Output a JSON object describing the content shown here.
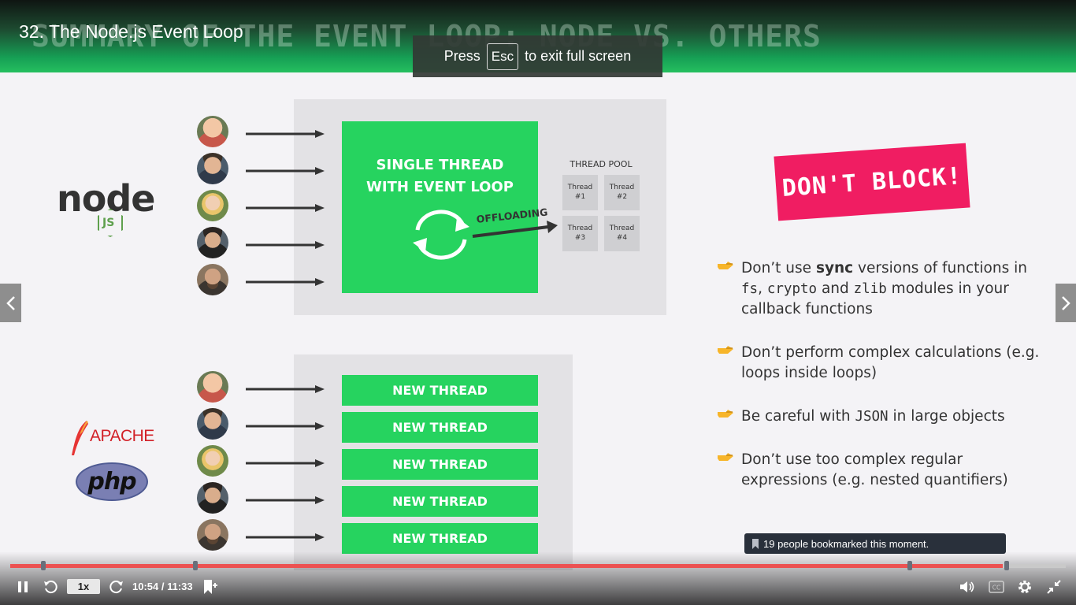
{
  "player": {
    "title": "32. The Node.js Event Loop",
    "fullscreen_toast": {
      "before": "Press",
      "key": "Esc",
      "after": "to exit full screen"
    },
    "bookmark_tooltip": "19 people bookmarked this moment.",
    "playback_rate": "1x",
    "time": "10:54 / 11:33",
    "progress": 0.94,
    "bookmarks": [
      0.031,
      0.175,
      0.852,
      0.944
    ]
  },
  "slide": {
    "header": "SUMMARY OF THE EVENT LOOP: NODE VS. OTHERS",
    "logos": {
      "node": "node",
      "node_badge": "JS",
      "apache": "APACHE",
      "php": "php"
    },
    "single_thread_label": "SINGLE THREAD\nWITH EVENT LOOP",
    "offloading": "OFFLOADING",
    "thread_pool": {
      "title": "THREAD POOL",
      "threads": [
        "Thread\n#1",
        "Thread\n#2",
        "Thread\n#3",
        "Thread\n#4"
      ]
    },
    "new_threads": [
      "NEW THREAD",
      "NEW THREAD",
      "NEW THREAD",
      "NEW THREAD",
      "NEW THREAD"
    ],
    "banner": "DON'T BLOCK!",
    "tips": [
      {
        "parts": [
          {
            "t": "Don’t use ",
            "s": "n"
          },
          {
            "t": "sync",
            "s": "b"
          },
          {
            "t": " versions of functions in ",
            "s": "n"
          },
          {
            "t": "fs",
            "s": "m"
          },
          {
            "t": ", ",
            "s": "n"
          },
          {
            "t": "crypto",
            "s": "m"
          },
          {
            "t": " and ",
            "s": "n"
          },
          {
            "t": "zlib",
            "s": "m"
          },
          {
            "t": " modules in your callback functions",
            "s": "n"
          }
        ]
      },
      {
        "parts": [
          {
            "t": "Don’t perform complex calculations (e.g. loops inside loops)",
            "s": "n"
          }
        ]
      },
      {
        "parts": [
          {
            "t": "Be careful with ",
            "s": "n"
          },
          {
            "t": "JSON",
            "s": "m"
          },
          {
            "t": " in large objects",
            "s": "n"
          }
        ]
      },
      {
        "parts": [
          {
            "t": "Don’t use too complex regular expressions (e.g. nested quantifiers)",
            "s": "n"
          }
        ]
      }
    ]
  },
  "colors": {
    "accent_green": "#26d35f",
    "banner_pink": "#f01d62",
    "progress_red": "#ec5252"
  }
}
